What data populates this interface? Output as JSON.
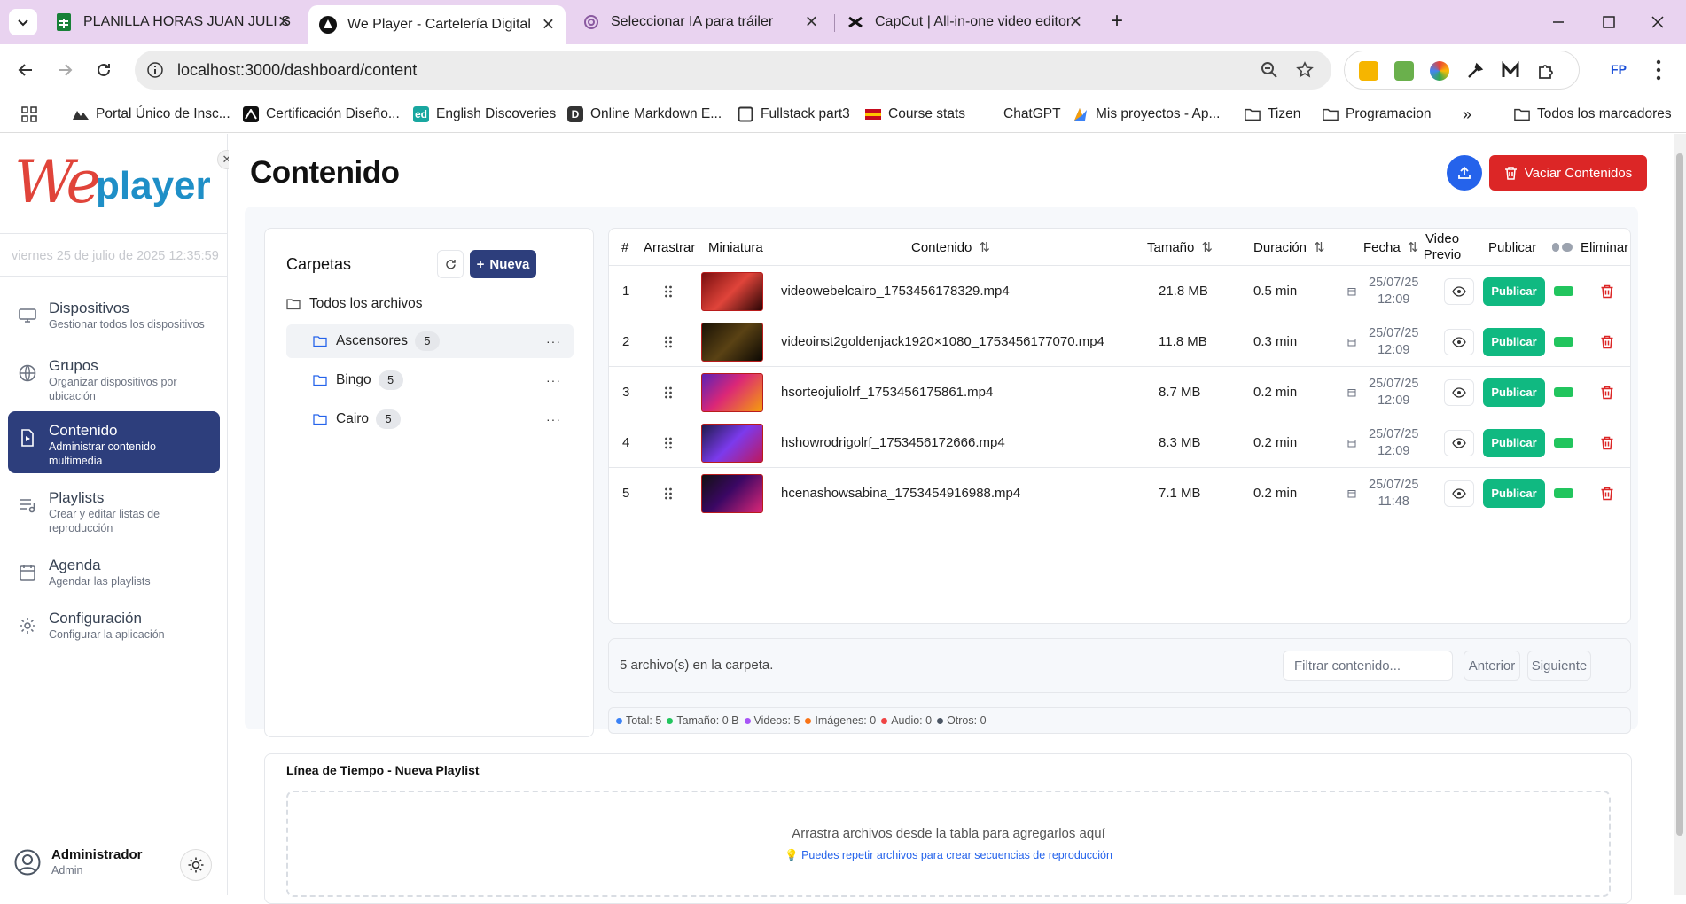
{
  "browser": {
    "tabs": [
      {
        "title": "PLANILLA HORAS JUAN JULI SE",
        "icon": "sheets-icon"
      },
      {
        "title": "We Player - Cartelería Digital",
        "icon": "weplayer-icon"
      },
      {
        "title": "Seleccionar IA para tráiler",
        "icon": "openai-icon"
      },
      {
        "title": "CapCut | All-in-one video editor",
        "icon": "capcut-icon"
      }
    ],
    "url": "localhost:3000/dashboard/content",
    "bookmarks": [
      "Portal Único de Insc...",
      "Certificación Diseño...",
      "English Discoveries",
      "Online Markdown E...",
      "Fullstack part3",
      "Course stats",
      "ChatGPT",
      "Mis proyectos - Ap...",
      "Tizen",
      "Programacion",
      "Todos los marcadores"
    ],
    "profile_badge": "FP"
  },
  "sidebar": {
    "logo_we": "We",
    "logo_player": "player",
    "datetime": "viernes 25 de julio de 2025 12:35:59",
    "nav": [
      {
        "title": "Dispositivos",
        "subtitle": "Gestionar todos los dispositivos"
      },
      {
        "title": "Grupos",
        "subtitle": "Organizar dispositivos por ubicación"
      },
      {
        "title": "Contenido",
        "subtitle": "Administrar contenido multimedia"
      },
      {
        "title": "Playlists",
        "subtitle": "Crear y editar listas de reproducción"
      },
      {
        "title": "Agenda",
        "subtitle": "Agendar las playlists"
      },
      {
        "title": "Configuración",
        "subtitle": "Configurar la aplicación"
      }
    ],
    "user": {
      "name": "Administrador",
      "role": "Admin"
    }
  },
  "main": {
    "title": "Contenido",
    "clear_label": "Vaciar Contenidos",
    "folders": {
      "heading": "Carpetas",
      "new_label": "Nueva",
      "all_files": "Todos los archivos",
      "items": [
        {
          "name": "Ascensores",
          "count": "5"
        },
        {
          "name": "Bingo",
          "count": "5"
        },
        {
          "name": "Cairo",
          "count": "5"
        }
      ]
    },
    "table": {
      "headers": {
        "num": "#",
        "drag": "Arrastrar",
        "thumb": "Miniatura",
        "content": "Contenido",
        "size": "Tamaño",
        "duration": "Duración",
        "date": "Fecha",
        "preview1": "Video",
        "preview2": "Previo",
        "publish": "Publicar",
        "delete": "Eliminar"
      },
      "rows": [
        {
          "n": "1",
          "name": "videowebelcairo_1753456178329.mp4",
          "size": "21.8 MB",
          "duration": "0.5 min",
          "date": "25/07/25",
          "time": "12:09",
          "publish": "Publicar"
        },
        {
          "n": "2",
          "name": "videoinst2goldenjack1920×1080_1753456177070.mp4",
          "size": "11.8 MB",
          "duration": "0.3 min",
          "date": "25/07/25",
          "time": "12:09",
          "publish": "Publicar"
        },
        {
          "n": "3",
          "name": "hsorteojuliolrf_1753456175861.mp4",
          "size": "8.7 MB",
          "duration": "0.2 min",
          "date": "25/07/25",
          "time": "12:09",
          "publish": "Publicar"
        },
        {
          "n": "4",
          "name": "hshowrodrigolrf_1753456172666.mp4",
          "size": "8.3 MB",
          "duration": "0.2 min",
          "date": "25/07/25",
          "time": "12:09",
          "publish": "Publicar"
        },
        {
          "n": "5",
          "name": "hcenashowsabina_1753454916988.mp4",
          "size": "7.1 MB",
          "duration": "0.2 min",
          "date": "25/07/25",
          "time": "11:48",
          "publish": "Publicar"
        }
      ]
    },
    "footer": {
      "count_text": "5 archivo(s) en la carpeta.",
      "filter_placeholder": "Filtrar contenido...",
      "prev": "Anterior",
      "next": "Siguiente"
    },
    "stats": [
      {
        "label": "Total: 5",
        "color": "#3b82f6"
      },
      {
        "label": "Tamaño: 0 B",
        "color": "#22c55e"
      },
      {
        "label": "Videos: 5",
        "color": "#a855f7"
      },
      {
        "label": "Imágenes: 0",
        "color": "#f97316"
      },
      {
        "label": "Audio: 0",
        "color": "#ef4444"
      },
      {
        "label": "Otros: 0",
        "color": "#4b5563"
      }
    ],
    "timeline": {
      "heading": "Línea de Tiempo - Nueva Playlist",
      "drop_text": "Arrastra archivos desde la tabla para agregarlos aquí",
      "hint": "💡 Puedes repetir archivos para crear secuencias de reproducción"
    }
  },
  "colors": {
    "accent": "#2d3e7c",
    "danger": "#dc2626",
    "success": "#10b981",
    "primary": "#2563eb"
  }
}
